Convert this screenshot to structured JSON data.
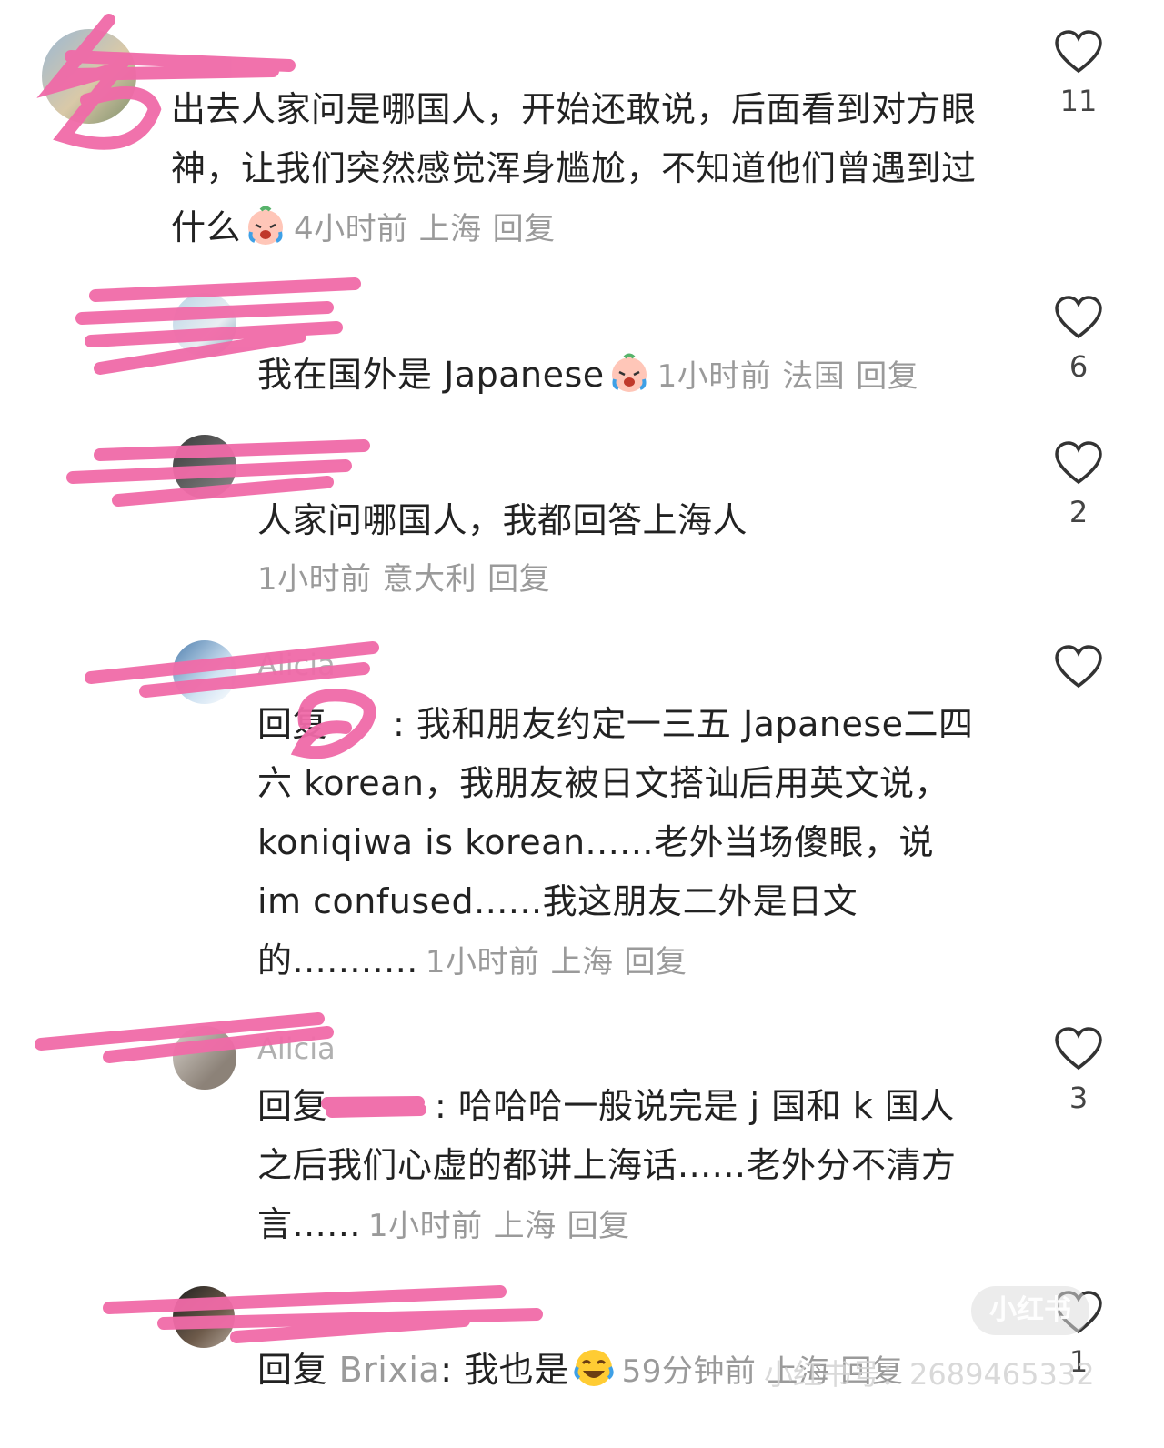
{
  "colors": {
    "scribble": "#f06aa8",
    "meta": "#9a9a9a",
    "text": "#222222"
  },
  "comments": [
    {
      "body": "出去人家问是哪国人，开始还敢说，后面看到对方眼神，让我们突然感觉浑身尴尬，不知道他们曾遇到过什么",
      "emoji": "crying-laughing-face-emoji",
      "time": "4小时前",
      "location": "上海",
      "reply": "回复",
      "likes": "11"
    },
    {
      "body": "我在国外是 Japanese",
      "emoji": "crying-laughing-face-emoji",
      "time": "1小时前",
      "location": "法国",
      "reply": "回复",
      "likes": "6"
    },
    {
      "body": "人家问哪国人，我都回答上海人",
      "time": "1小时前",
      "location": "意大利",
      "reply": "回复",
      "likes": "2"
    },
    {
      "username": "Alicia",
      "reply_prefix": "回复",
      "body": ": 我和朋友约定一三五 Japanese二四六 korean，我朋友被日文搭讪后用英文说，koniqiwa is korean......老外当场傻眼，说 im confused......我这朋友二外是日文的...........",
      "time": "1小时前",
      "location": "上海",
      "reply": "回复",
      "likes": ""
    },
    {
      "username": "Alicia",
      "reply_prefix": "回复",
      "body": ": 哈哈哈一般说完是 j 国和 k 国人之后我们心虚的都讲上海话......老外分不清方言......",
      "time": "1小时前",
      "location": "上海",
      "reply": "回复",
      "likes": "3"
    },
    {
      "reply_prefix": "回复",
      "reply_target": "Brixia",
      "body": ": 我也是",
      "emoji": "tears-of-joy-emoji",
      "time": "59分钟前",
      "location": "上海",
      "reply": "回复",
      "likes": "1"
    }
  ],
  "watermark": {
    "badge": "小红书",
    "text": "小红书号：2689465332"
  }
}
